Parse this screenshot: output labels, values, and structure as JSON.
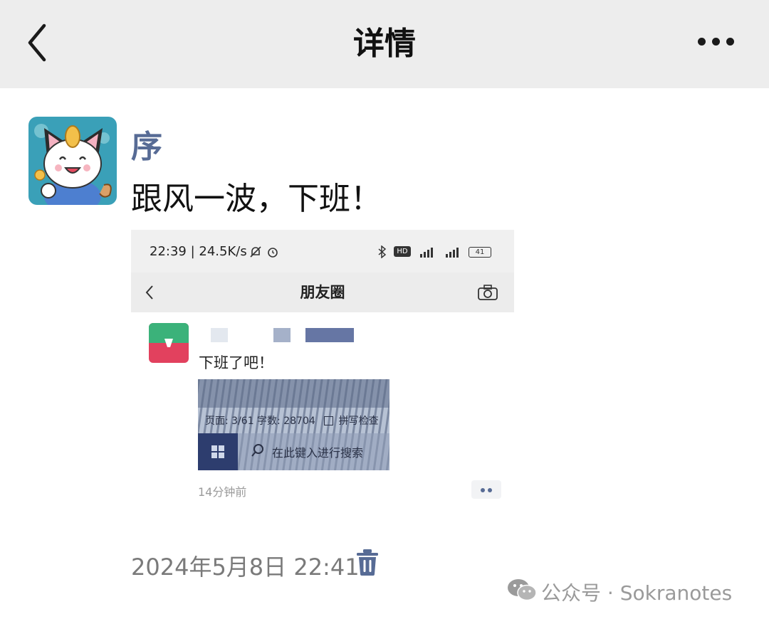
{
  "nav": {
    "title": "详情",
    "back_icon": "chevron-left-icon",
    "more_icon": "more-horizontal-icon"
  },
  "post": {
    "username": "序",
    "text": "跟风一波，下班！",
    "date": "2024年5月8日 22:41",
    "delete_icon": "trash-icon"
  },
  "screenshot": {
    "status_time": "22:39 | 24.5K/s",
    "status_icons": [
      "silent-bell-icon",
      "alarm-icon",
      "bluetooth-icon",
      "hd-icon",
      "signal-icon",
      "signal-icon",
      "battery-icon"
    ],
    "battery": "41",
    "nav_title": "朋友圈",
    "post_text": "下班了吧！",
    "photo_row1": "页面: 3/61    字数: 28704",
    "photo_row1_check": "拼写检查",
    "photo_search": "在此键入进行搜索",
    "time_ago": "14分钟前"
  },
  "watermark": {
    "text": "公众号 · Sokranotes"
  },
  "colors": {
    "nav_bg": "#ededed",
    "username": "#576b95",
    "date": "#7a7a7a",
    "delete_icon": "#576b95"
  }
}
